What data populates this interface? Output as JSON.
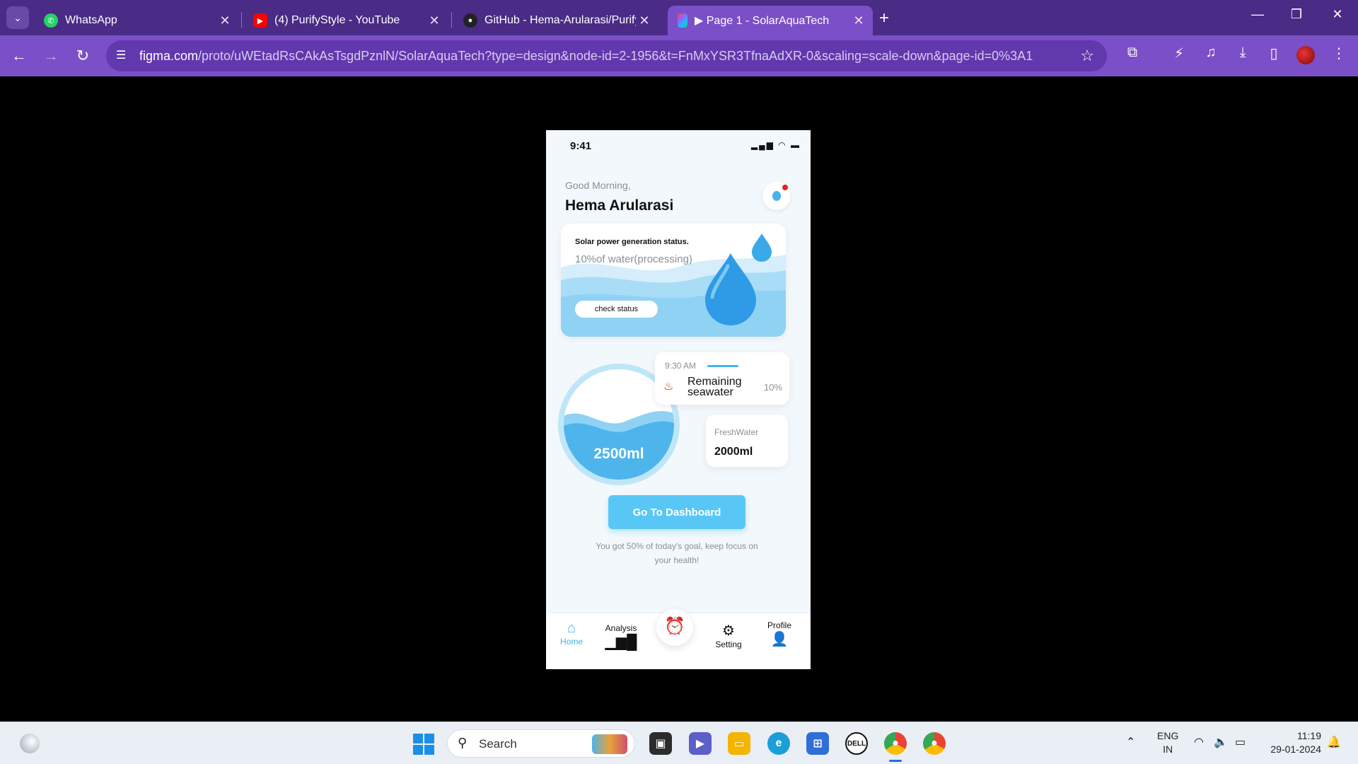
{
  "browser": {
    "tabs": [
      {
        "title": "WhatsApp",
        "icon": "whatsapp-icon",
        "color": "#25d366"
      },
      {
        "title": "(4) PurifyStyle - YouTube",
        "icon": "youtube-icon",
        "color": "#ff0000"
      },
      {
        "title": "GitHub - Hema-Arularasi/Purify",
        "icon": "github-icon",
        "color": "#222222"
      },
      {
        "title": "▶ Page 1 - SolarAquaTech",
        "icon": "figma-icon",
        "color": "#a259ff"
      }
    ],
    "url_host": "figma.com",
    "url_path": "/proto/uWEtadRsCAkAsTsgdPznlN/SolarAquaTech?type=design&node-id=2-1956&t=FnMxYSR3TfnaAdXR-0&scaling=scale-down&page-id=0%3A1",
    "accent": "#7b4fc7"
  },
  "app": {
    "status_time": "9:41",
    "greeting": "Good Morning,",
    "user_name": "Hema Arularasi",
    "solar_card": {
      "title": "Solar power generation status.",
      "subtitle": "10%of water(processing)",
      "button": "check status"
    },
    "water_level": {
      "value": "2500ml",
      "fill_fraction": 0.55
    },
    "remaining": {
      "time": "9:30 AM",
      "label": "Remaining seawater",
      "percent": "10%"
    },
    "fresh": {
      "label": "FreshWater",
      "value": "2000ml"
    },
    "dashboard_button": "Go To Dashboard",
    "goal_text": "You got 50% of today's goal, keep focus on your health!",
    "nav": {
      "home": "Home",
      "analysis": "Analysis",
      "setting": "Setting",
      "profile": "Profile"
    },
    "primary_color": "#59c7f5"
  },
  "taskbar": {
    "search_label": "Search",
    "lang_1": "ENG",
    "lang_2": "IN",
    "time": "11:19",
    "date": "29-01-2024"
  }
}
